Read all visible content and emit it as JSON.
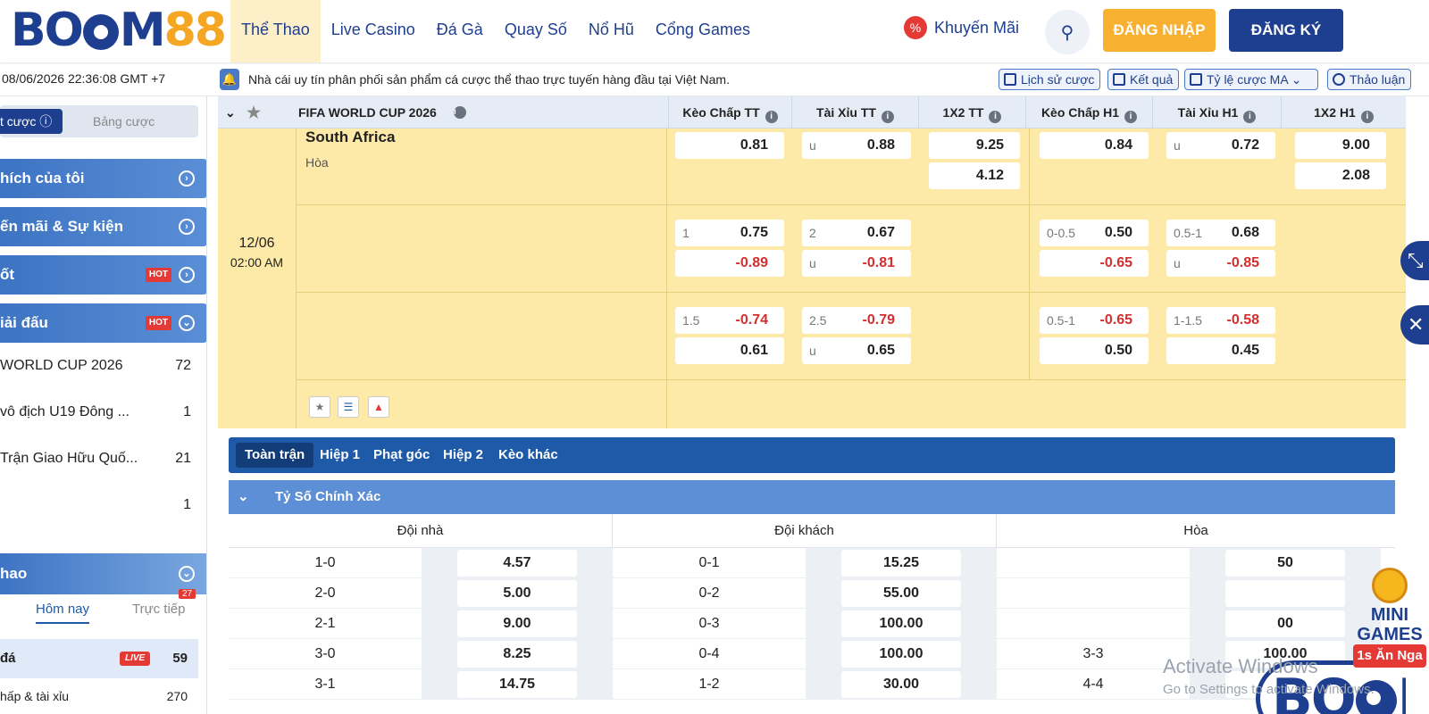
{
  "header": {
    "logo_a": "BO",
    "logo_b": "M",
    "logo_c": "88",
    "nav": [
      "Thể Thao",
      "Live Casino",
      "Đá Gà",
      "Quay Số",
      "Nổ Hũ",
      "Cổng Games"
    ],
    "promo": "Khuyến Mãi",
    "login": "ĐĂNG NHẬP",
    "register": "ĐĂNG KÝ"
  },
  "topbar": {
    "datetime": "08/06/2026 22:36:08 GMT +7",
    "notice": "Nhà cái uy tín phân phối sản phẩm cá cược thể thao trực tuyến hàng đầu tại Việt Nam.",
    "buttons": [
      "Lịch sử cược",
      "Kết quả",
      "Tỷ lệ cược MA",
      "Thảo luận"
    ]
  },
  "sidebar": {
    "tab_active": "t cược",
    "tab_other": "Bảng cược",
    "items": [
      "hích của tôi",
      "ến mãi & Sự kiện",
      "ốt",
      "iải đấu"
    ],
    "hot": "HOT",
    "leagues": [
      {
        "name": "WORLD CUP 2026",
        "count": "72"
      },
      {
        "name": "vô địch U19 Đông ...",
        "count": "1"
      },
      {
        "name": "Trận Giao Hữu Quố...",
        "count": "21"
      },
      {
        "name": "",
        "count": "1"
      }
    ],
    "sport": "hao",
    "sub_today": "Hôm nay",
    "sub_live": "Trực tiếp",
    "live_badge": "27",
    "live_row": {
      "label": "đá",
      "live": "LIVE",
      "count": "59"
    },
    "last_row": {
      "label": "hấp & tài xỉu",
      "count": "270"
    }
  },
  "league_header": {
    "name": "FIFA WORLD CUP 2026",
    "cols": [
      "Kèo Chấp TT",
      "Tài Xỉu TT",
      "1X2 TT",
      "Kèo Chấp H1",
      "Tài Xỉu H1",
      "1X2 H1"
    ]
  },
  "match": {
    "date": "12/06",
    "time": "02:00 AM",
    "team": "South Africa",
    "draw": "Hòa",
    "row1": {
      "kc": "0.81",
      "tx_h": "u",
      "tx": "0.88",
      "x12a": "9.25",
      "x12b": "4.12",
      "kc1": "0.84",
      "tx1_h": "u",
      "tx1": "0.72",
      "x121a": "9.00",
      "x121b": "2.08"
    },
    "row2": {
      "kc_h": "1",
      "kc": "0.75",
      "kc_b": "-0.89",
      "tx_h": "2",
      "tx": "0.67",
      "tx_bh": "u",
      "tx_b": "-0.81",
      "kc1_h": "0-0.5",
      "kc1": "0.50",
      "kc1_b": "-0.65",
      "tx1_h": "0.5-1",
      "tx1": "0.68",
      "tx1_bh": "u",
      "tx1_b": "-0.85"
    },
    "row3": {
      "kc_h": "1.5",
      "kc": "-0.74",
      "kc_b": "0.61",
      "tx_h": "2.5",
      "tx": "-0.79",
      "tx_bh": "u",
      "tx_b": "0.65",
      "kc1_h": "0.5-1",
      "kc1": "-0.65",
      "kc1_b": "0.50",
      "tx1_h": "1-1.5",
      "tx1": "-0.58",
      "tx1_b": "0.45"
    }
  },
  "subtabs": [
    "Toàn trận",
    "Hiệp 1",
    "Phạt góc",
    "Hiệp 2",
    "Kèo khác"
  ],
  "section": "Tỷ Số Chính Xác",
  "cs_cols": [
    "Đội nhà",
    "Đội khách",
    "Hòa"
  ],
  "cs_rows": [
    {
      "h": "1-0",
      "ho": "4.57",
      "a": "0-1",
      "ao": "15.25",
      "d": "",
      "do": "50"
    },
    {
      "h": "2-0",
      "ho": "5.00",
      "a": "0-2",
      "ao": "55.00",
      "d": "",
      "do": ""
    },
    {
      "h": "2-1",
      "ho": "9.00",
      "a": "0-3",
      "ao": "100.00",
      "d": "",
      "do": "00"
    },
    {
      "h": "3-0",
      "ho": "8.25",
      "a": "0-4",
      "ao": "100.00",
      "d": "3-3",
      "do": "100.00"
    },
    {
      "h": "3-1",
      "ho": "14.75",
      "a": "1-2",
      "ao": "30.00",
      "d": "4-4",
      "do": "100.00"
    }
  ],
  "overlay": {
    "mini1": "MINI",
    "mini2": "GAMES",
    "mini3": "1s Ăn Nga"
  },
  "watermark": {
    "l1": "Activate Windows",
    "l2": "Go to Settings to activate Windows."
  },
  "colors": {
    "brand": "#1e3f8f",
    "accent": "#f7b030",
    "row": "#fde9a8",
    "negative": "#d32f2f"
  }
}
